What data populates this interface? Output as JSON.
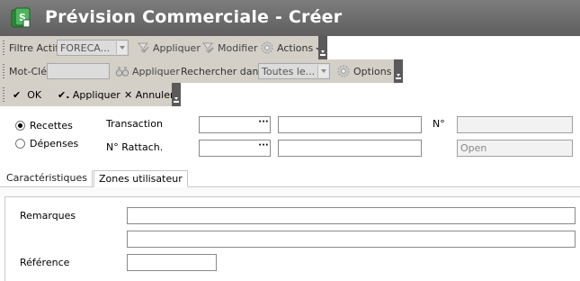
{
  "window": {
    "title": "Prévision Commerciale - Créer"
  },
  "toolbar1": {
    "filter_label": "Filtre Actif",
    "filter_value": "FORECA...",
    "apply_label": "Appliquer",
    "modify_label": "Modifier",
    "actions_label": "Actions"
  },
  "toolbar2": {
    "keyword_label": "Mot-Clé",
    "keyword_value": "",
    "apply_label": "Appliquer",
    "search_in_label": "Rechercher dans",
    "search_in_value": "Toutes le...",
    "options_label": "Options"
  },
  "toolbar3": {
    "ok_label": "OK",
    "ok_apply_label": "Appliquer",
    "cancel_label": "Annuler"
  },
  "header": {
    "radio_income": "Recettes",
    "radio_expense": "Dépenses",
    "selected": "Recettes",
    "transaction_label": "Transaction",
    "transaction_code": "",
    "transaction_desc": "",
    "number_label": "N°",
    "number_value": "",
    "link_label": "N° Rattach.",
    "link_code": "",
    "link_desc": "",
    "status_value": "Open"
  },
  "tabs": [
    {
      "label": "Caractéristiques",
      "active": false
    },
    {
      "label": "Zones utilisateur",
      "active": true
    }
  ],
  "user_zones": {
    "remarks_label": "Remarques",
    "remarks_line1": "",
    "remarks_line2": "",
    "reference_label": "Référence",
    "reference_value": ""
  }
}
